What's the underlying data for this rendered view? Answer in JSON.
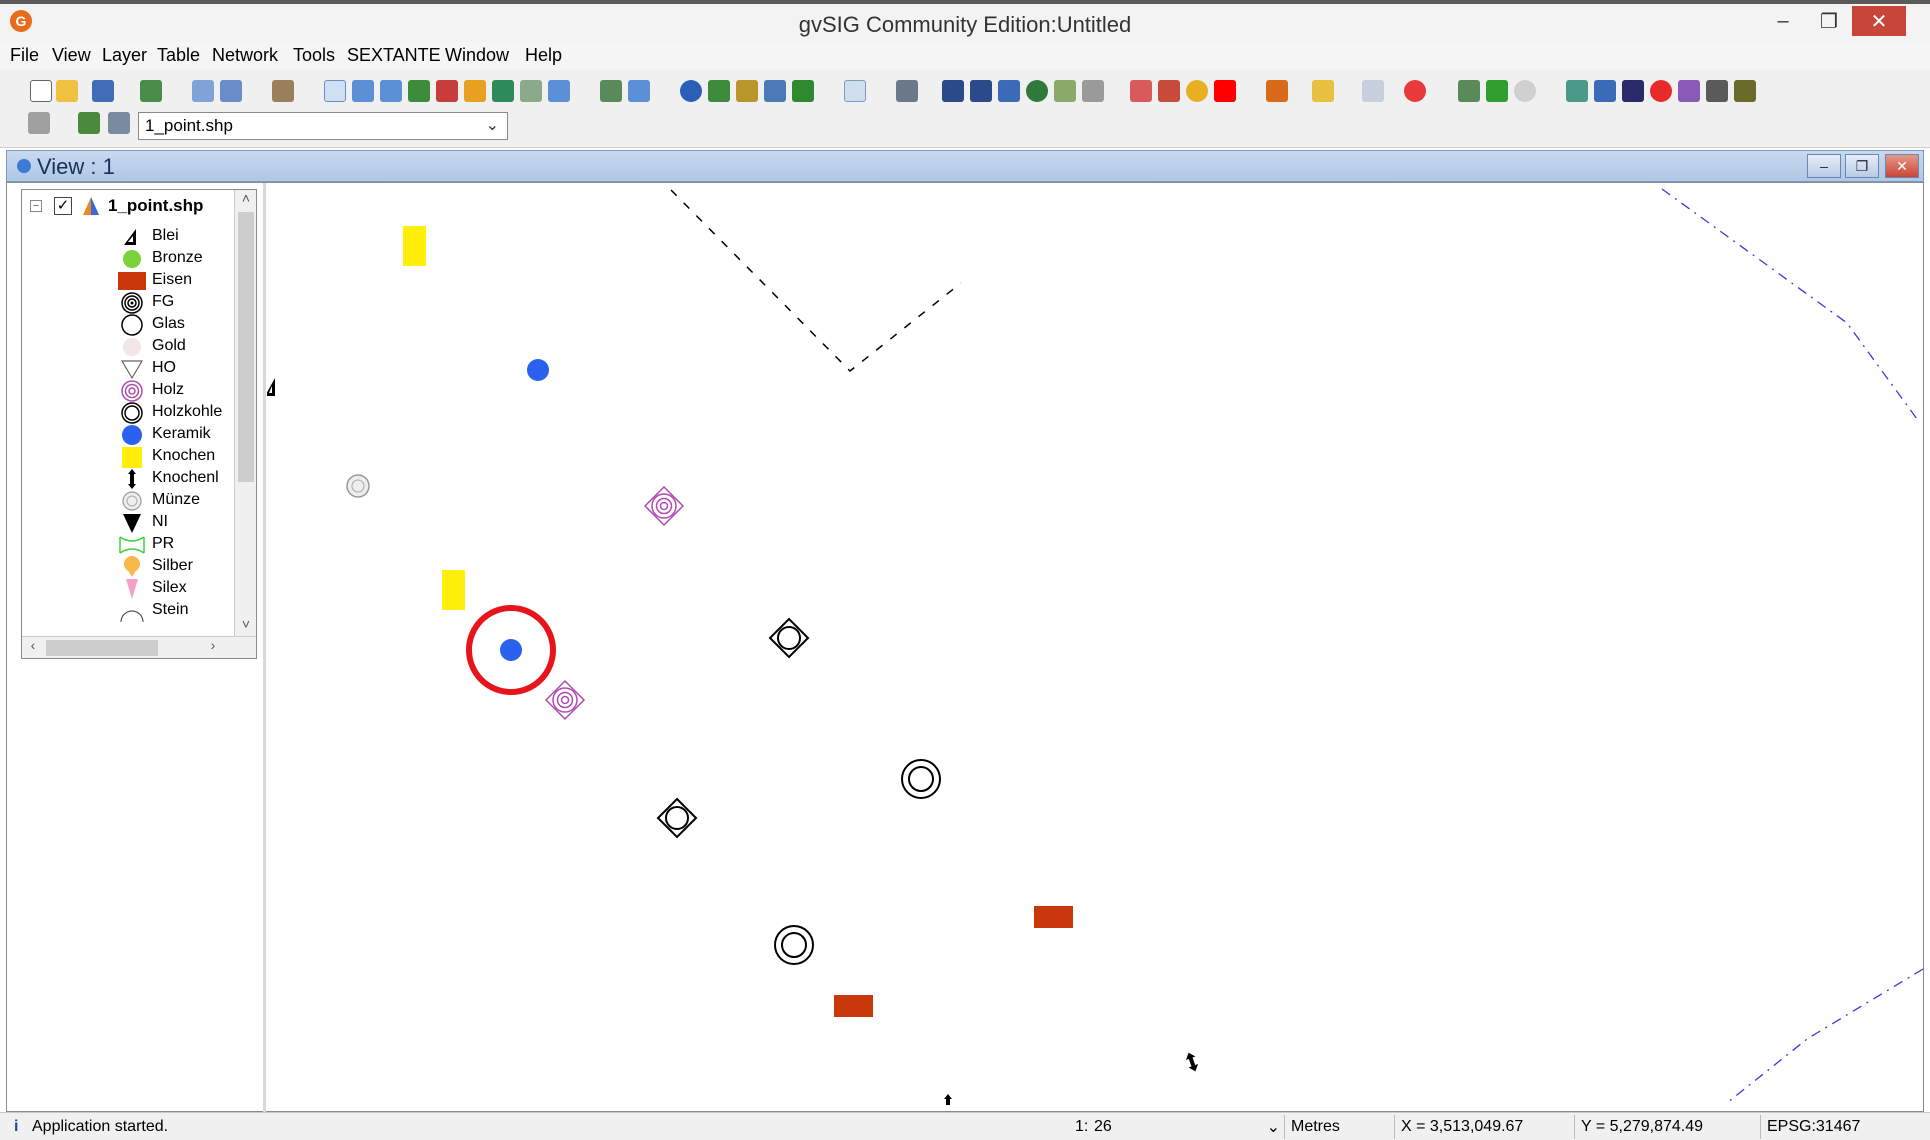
{
  "window": {
    "title": "gvSIG Community Edition:Untitled"
  },
  "menu": [
    "File",
    "View",
    "Layer",
    "Table",
    "Network",
    "Tools",
    "SEXTANTE",
    "Window",
    "Help"
  ],
  "toolbar": {
    "active_layer": "1_point.shp"
  },
  "view": {
    "title": "View : 1"
  },
  "toc": {
    "layer_name": "1_point.shp",
    "layer_checked": true,
    "legend": [
      {
        "label": "Blei",
        "symbol": "black-triangle-icon"
      },
      {
        "label": "Bronze",
        "symbol": "green-circle-icon",
        "color": "#7ad23c"
      },
      {
        "label": "Eisen",
        "symbol": "red-rectangle-icon",
        "color": "#c8380b"
      },
      {
        "label": "FG",
        "symbol": "target-circle-icon"
      },
      {
        "label": "Glas",
        "symbol": "open-circle-icon"
      },
      {
        "label": "Gold",
        "symbol": "pale-circle-icon",
        "color": "#f2e6e6"
      },
      {
        "label": "HO",
        "symbol": "down-triangle-outline-icon"
      },
      {
        "label": "Holz",
        "symbol": "purple-concentric-diamond-icon",
        "color": "#b04cb0"
      },
      {
        "label": "Holzkohle",
        "symbol": "black-double-circle-icon"
      },
      {
        "label": "Keramik",
        "symbol": "blue-circle-icon",
        "color": "#2a61ef"
      },
      {
        "label": "Knochen",
        "symbol": "yellow-rectangle-icon",
        "color": "#ffef0a"
      },
      {
        "label": "Knochenl",
        "symbol": "black-arrows-icon"
      },
      {
        "label": "Münze",
        "symbol": "grey-coin-icon"
      },
      {
        "label": "NI",
        "symbol": "black-down-triangle-icon"
      },
      {
        "label": "PR",
        "symbol": "green-x-shape-icon",
        "color": "#3cd23c"
      },
      {
        "label": "Silber",
        "symbol": "orange-balloon-icon",
        "color": "#f8b94a"
      },
      {
        "label": "Silex",
        "symbol": "pink-drop-icon",
        "color": "#f5a0c8"
      },
      {
        "label": "Stein",
        "symbol": "half-circle-outline-icon"
      }
    ]
  },
  "status": {
    "message": "Application started.",
    "scale_prefix": "1:",
    "scale": "26",
    "units": "Metres",
    "x": "X = 3,513,049.67",
    "y": "Y = 5,279,874.49",
    "epsg": "EPSG:31467"
  },
  "colors": {
    "highlight": "#e8141c",
    "keramik": "#2a61ef",
    "eisen": "#c8380b",
    "knochen": "#ffef0a",
    "holz": "#b04cb0"
  }
}
